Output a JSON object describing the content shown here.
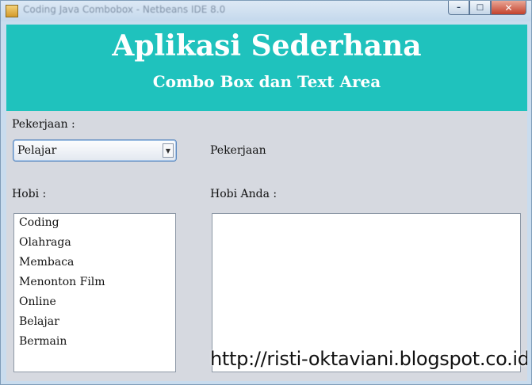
{
  "window": {
    "title": "Coding Java Combobox - Netbeans IDE 8.0",
    "icon": "java-app-icon",
    "controls": {
      "minimize": "–",
      "maximize": "□",
      "close": "✕"
    }
  },
  "header": {
    "title": "Aplikasi Sederhana",
    "subtitle": "Combo Box dan Text Area",
    "background": "#1fc2bd"
  },
  "form": {
    "pekerjaan_label": "Pekerjaan :",
    "pekerjaan_selected": "Pelajar",
    "pekerjaan_output": "Pekerjaan",
    "hobi_label": "Hobi :",
    "hobi_items": [
      "Coding",
      "Olahraga",
      "Membaca",
      "Menonton Film",
      "Online",
      "Belajar",
      "Bermain"
    ],
    "hobi_anda_label": "Hobi Anda :",
    "hobi_anda_value": ""
  },
  "watermark": "http://risti-oktaviani.blogspot.co.id/"
}
